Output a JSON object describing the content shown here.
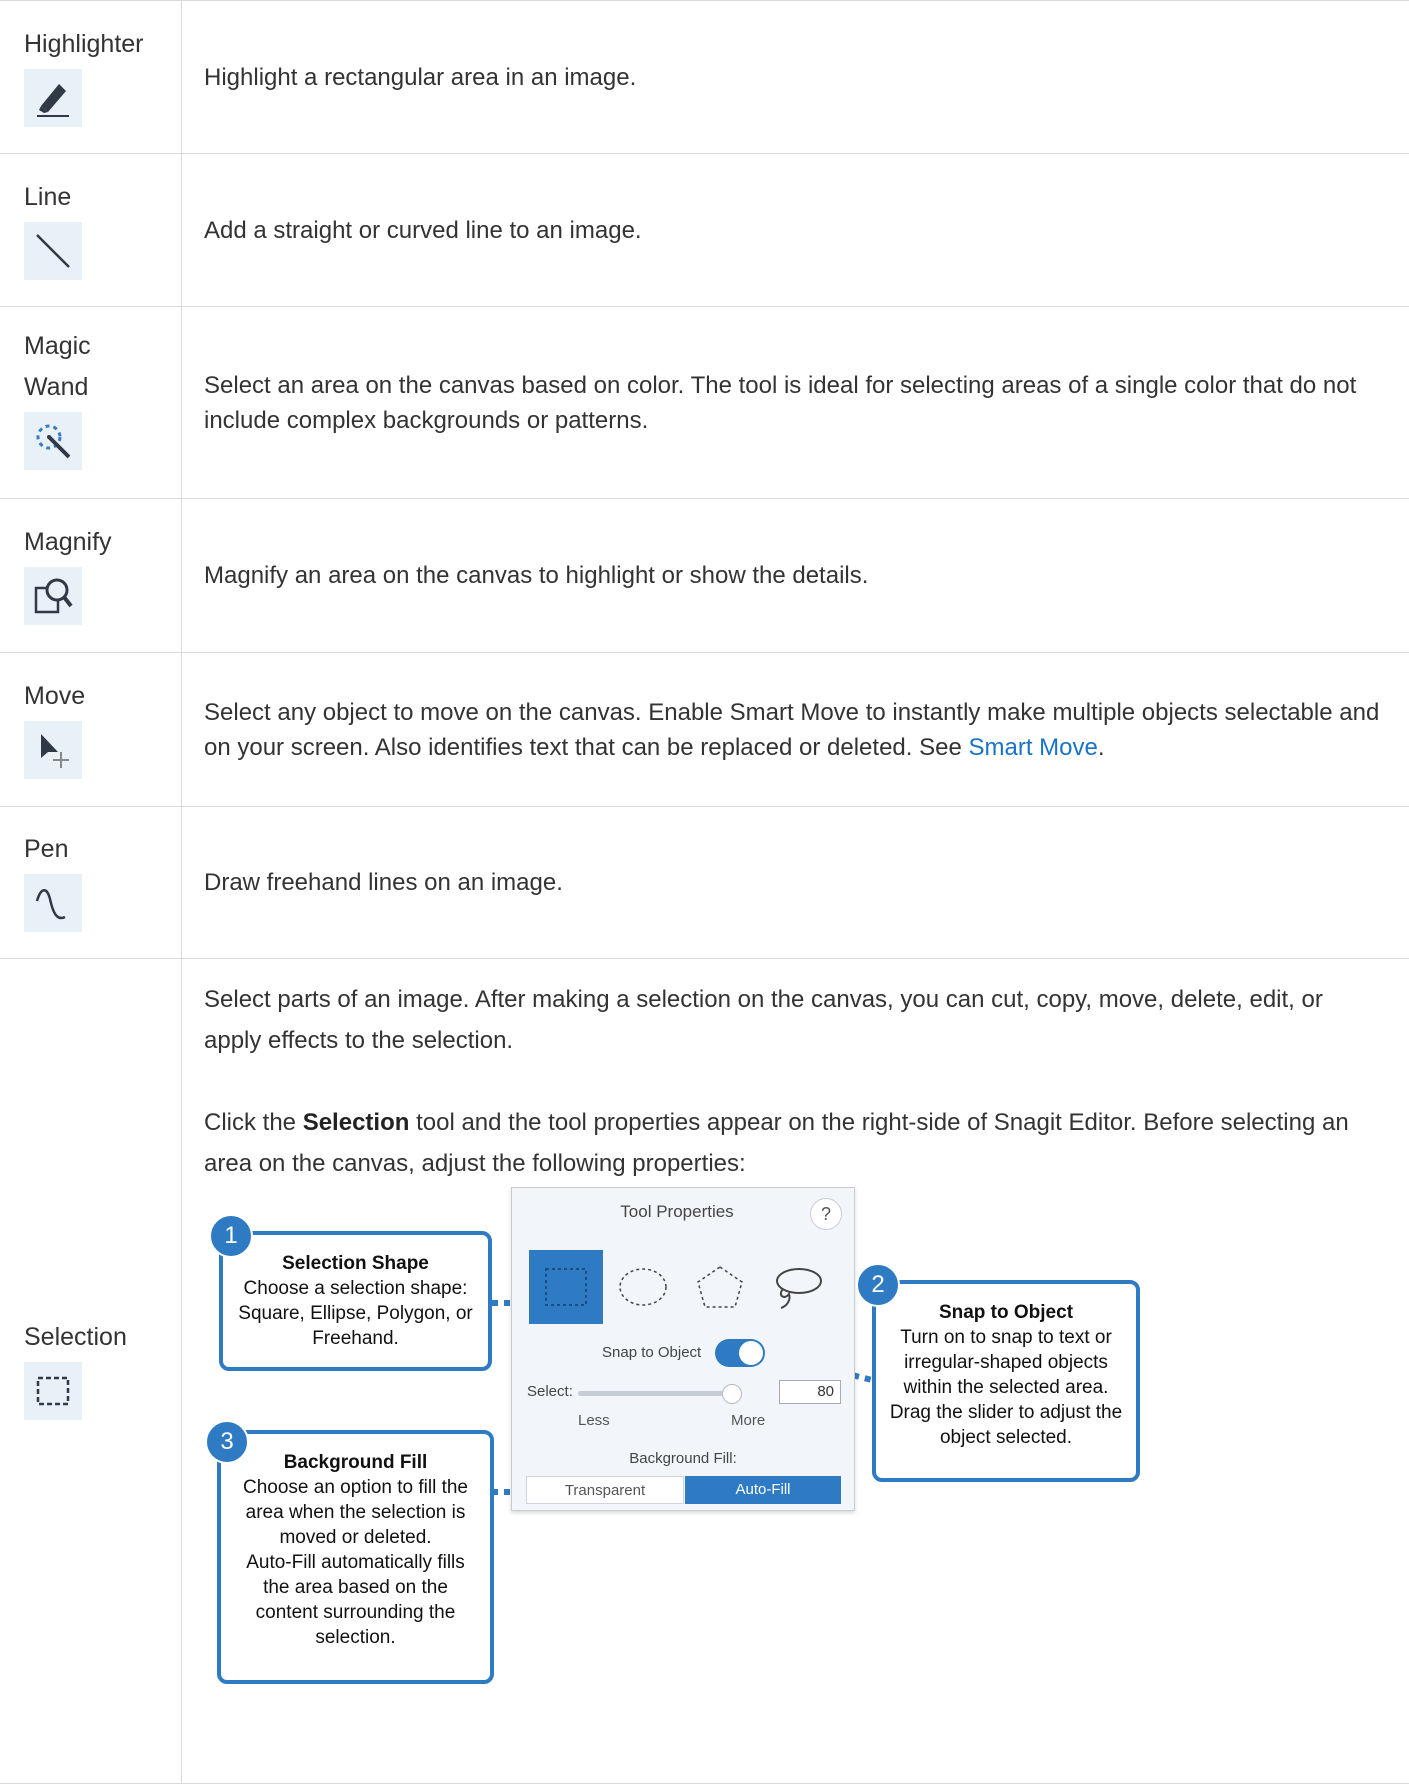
{
  "rows": [
    {
      "name": "Highlighter",
      "icon": "highlighter-icon",
      "desc": "Highlight a rectangular area in an image."
    },
    {
      "name": "Line",
      "icon": "line-icon",
      "desc": "Add a straight or curved line to an image."
    },
    {
      "name_line1": "Magic",
      "name_line2": "Wand",
      "icon": "magic-wand-icon",
      "desc": "Select an area on the canvas based on color. The tool is ideal for selecting areas of a single color that do not include complex backgrounds or patterns."
    },
    {
      "name": "Magnify",
      "icon": "magnify-icon",
      "desc": "Magnify an area on the canvas to highlight or show the details."
    },
    {
      "name": "Move",
      "icon": "move-icon",
      "desc_before": "Select any object to move on the canvas. Enable Smart Move to instantly make multiple objects selectable and on your screen. Also identifies text that can be replaced or deleted. See ",
      "link": "Smart Move",
      "desc_after": "."
    },
    {
      "name": "Pen",
      "icon": "pen-icon",
      "desc": "Draw freehand lines on an image."
    },
    {
      "name": "Selection",
      "icon": "selection-icon",
      "desc1": "Select parts of an image. After making a selection on the canvas, you can cut, copy, move, delete, edit, or apply effects to the selection.",
      "desc2_before": "Click the ",
      "desc2_bold": "Selection",
      "desc2_after": " tool and the tool properties appear on the right-side of Snagit Editor. Before selecting an area on the canvas, adjust the following properties:"
    }
  ],
  "figure": {
    "panel_title": "Tool Properties",
    "help": "?",
    "snap_label": "Snap to Object",
    "select_label": "Select:",
    "select_value": "80",
    "less": "Less",
    "more": "More",
    "bg_fill_label": "Background Fill:",
    "btn_transparent": "Transparent",
    "btn_autofill": "Auto-Fill",
    "accent": "#2e7bc4",
    "callouts": [
      {
        "num": "1",
        "title": "Selection Shape",
        "text": "Choose a selection shape: Square, Ellipse, Polygon, or Freehand."
      },
      {
        "num": "2",
        "title": "Snap to Object",
        "text": "Turn on to snap to text or irregular-shaped objects within the selected area. Drag the slider to adjust the object selected."
      },
      {
        "num": "3",
        "title": "Background Fill",
        "text": "Choose an option to fill the area when the selection is moved or deleted.",
        "text2": "Auto-Fill automatically fills the area based on the content surrounding the selection."
      }
    ]
  }
}
